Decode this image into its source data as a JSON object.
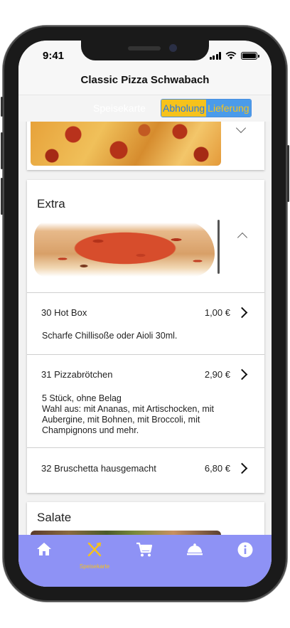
{
  "status": {
    "time": "9:41"
  },
  "header": {
    "title": "Classic Pizza Schwabach"
  },
  "tabs": {
    "menu_label": "Speisekarte",
    "segment": [
      "Abholung",
      "Lieferung"
    ]
  },
  "sections": [
    {
      "title": "Extra"
    },
    {
      "title": "Salate"
    }
  ],
  "items": [
    {
      "name": "30 Hot Box",
      "price": "1,00 €",
      "description": [
        "Scharfe Chillisoße oder Aioli 30ml."
      ]
    },
    {
      "name": "31 Pizzabrötchen",
      "price": "2,90 €",
      "description": [
        "5 Stück, ohne Belag",
        "Wahl aus: mit Ananas, mit Artischocken, mit",
        "Aubergine, mit Bohnen, mit Broccoli, mit",
        "Champignons und mehr."
      ]
    },
    {
      "name": "32 Bruschetta hausgemacht",
      "price": "6,80 €",
      "description": []
    }
  ],
  "nav": {
    "items": [
      {
        "icon": "home-icon",
        "label": ""
      },
      {
        "icon": "fork-knife-icon",
        "label": "Speisekarte"
      },
      {
        "icon": "cart-icon",
        "label": ""
      },
      {
        "icon": "cloche-icon",
        "label": ""
      },
      {
        "icon": "info-icon",
        "label": ""
      }
    ]
  },
  "colors": {
    "nav_bg": "#8e92f5",
    "accent_yellow": "#f6c21b",
    "accent_blue": "#4a9bea"
  }
}
